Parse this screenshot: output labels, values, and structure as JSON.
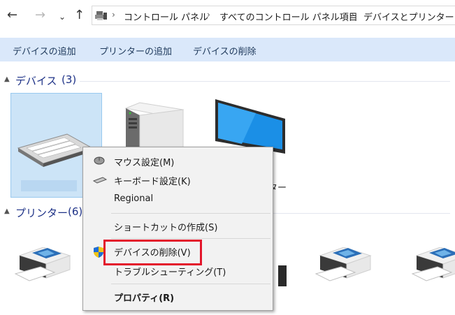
{
  "nav": {
    "back_label": "←",
    "forward_label": "→",
    "recent_label": "⌄",
    "up_label": "↑"
  },
  "address": {
    "sep": "›",
    "crumbs": [
      "コントロール パネル",
      "すべてのコントロール パネル項目",
      "デバイスとプリンター"
    ]
  },
  "toolbar": {
    "add_device": "デバイスの追加",
    "add_printer": "プリンターの追加",
    "remove_device": "デバイスの削除"
  },
  "groups": {
    "chevron": "▲",
    "devices": {
      "title": "デバイス",
      "count": "(3)"
    },
    "printers": {
      "title": "プリンター",
      "count": "(6)"
    }
  },
  "devices": {
    "monitor_label_tail": "ター"
  },
  "context_menu": {
    "items": [
      {
        "label": "マウス設定(M)",
        "icon": "mouse-icon"
      },
      {
        "label": "キーボード設定(K)",
        "icon": "keyboard-icon"
      },
      {
        "label": "Regional"
      },
      {
        "label": "ショートカットの作成(S)"
      },
      {
        "label": "デバイスの削除(V)",
        "icon": "uac-shield-icon"
      },
      {
        "label": "トラブルシューティング(T)"
      },
      {
        "label": "プロパティ(R)",
        "bold": true
      }
    ]
  },
  "colors": {
    "toolbar_bg": "#dae8fa",
    "group_title": "#1e3287",
    "selection": "#cce4f7",
    "highlight": "#e3152b"
  }
}
